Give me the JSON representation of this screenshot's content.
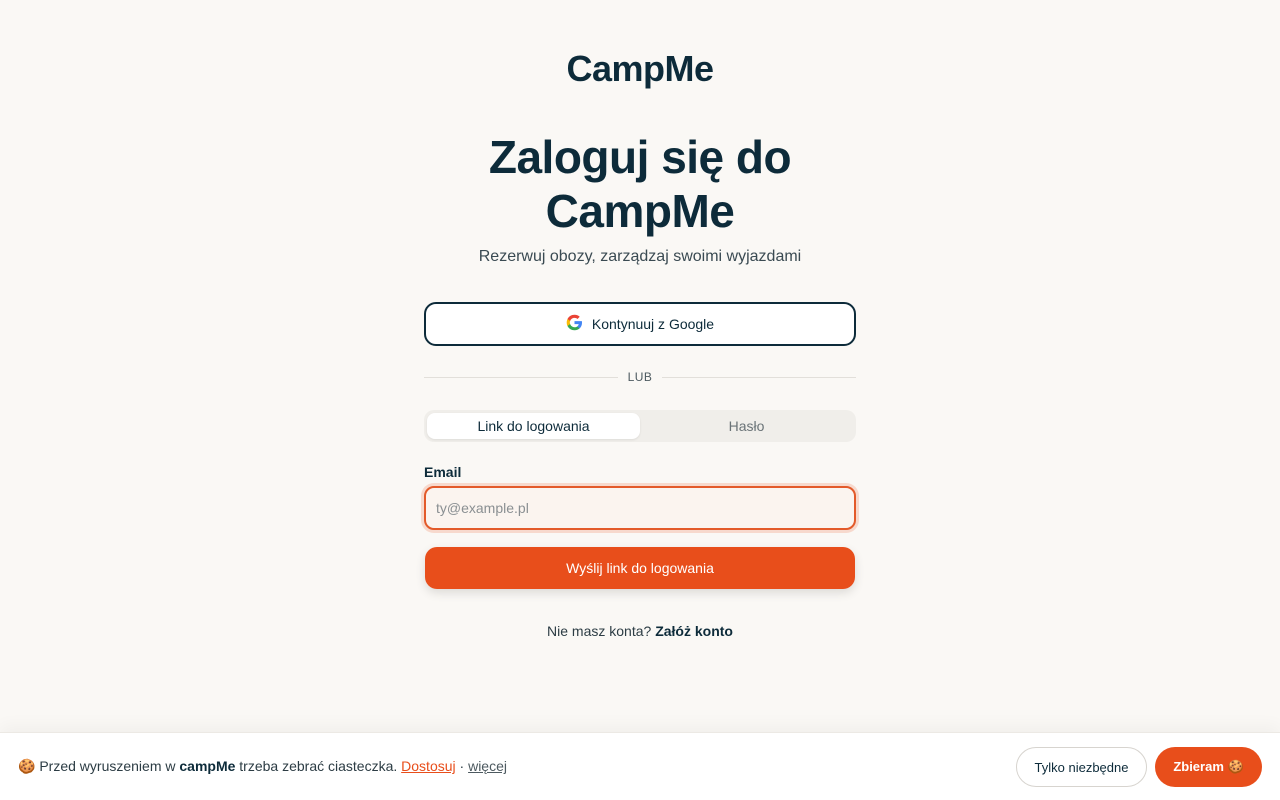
{
  "header": {
    "logo": "CampMe"
  },
  "main": {
    "title": "Zaloguj się do CampMe",
    "subtitle": "Rezerwuj obozy, zarządzaj swoimi wyjazdami",
    "google_button": "Kontynuuj z Google",
    "divider": "LUB",
    "tabs": [
      {
        "label": "Link do logowania",
        "active": true
      },
      {
        "label": "Hasło",
        "active": false
      }
    ],
    "email": {
      "label": "Email",
      "placeholder": "ty@example.pl",
      "value": ""
    },
    "submit": "Wyślij link do logowania",
    "signup": {
      "prompt": "Nie masz konta?",
      "link": "Załóż konto"
    }
  },
  "cookie": {
    "icon": "🍪",
    "text_before": "Przed wyruszeniem w",
    "brand": "campMe",
    "text_after": "trzeba zebrać ciasteczka.",
    "customize": "Dostosuj",
    "separator": "·",
    "more": "więcej",
    "essential_button": "Tylko niezbędne",
    "accept_button": "Zbieram 🍪"
  },
  "colors": {
    "accent": "#e84e1b",
    "primary": "#0d2b3a",
    "background": "#faf8f5"
  }
}
